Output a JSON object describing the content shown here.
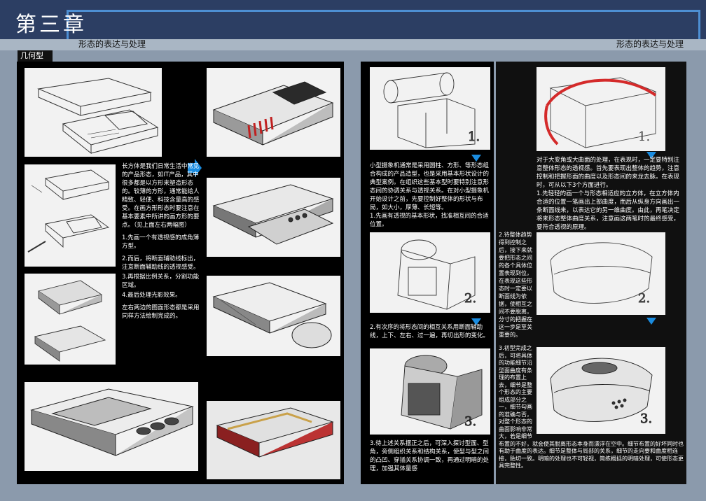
{
  "header": {
    "chapter_title": "第三章",
    "subtitle_left": "形态的表达与处理",
    "subtitle_right": "形态的表达与处理",
    "section_tag": "几何型"
  },
  "left_text": {
    "intro": "长方体是我们日常生活中常见的产品形态，如IT产品，其中很多都是以方形来塑造形态的。较薄的方形，通常能给人精致、轻便、科技含量高的感受。在画方形形态时要注意在基本要素中所讲的画方形的要点。（见上面左右两幅图）",
    "step1": "1.先画一个有透视感的成角薄方型。",
    "step2": "2.而后，将断面辅助线标出，注意断面辅助线的透视感受。",
    "step3": "3.再根据比例关系，分割功能区域。",
    "step4": "4.最后处理光影效果。",
    "outro": "左右两边的图面形态都是采用同样方法绘制完成的。"
  },
  "mid_text": {
    "intro": "小型摄象机通常是采用圆柱、方形、等形态组合构成的产品造型，也是采用基本形状设计的典型案例。在组织这些基本型时要特别注意形态间的协调关系与透视关系。在对小型摄象机开始设计之前，先要控制好整体的形状与布局，如大小，厚薄、长短等。",
    "step1": "1.先画有透视的基本形状，找准相互间的合适位置。",
    "step2": "2.有次序的将形态间的相互关系用断面辅助线，上下、左右、过一遍，再切出形的变化。",
    "step3": "3.待上述关系摆正之后，可深入探讨型面、型角，旁侧组织关系和结构关系，使型与型之间的凸凹、穿插关系协调一致，再通过明暗的处理，加强其体量感"
  },
  "right_text": {
    "intro": "对于大变角或大曲面的处理，在表现时，一定要特别注意整体形态的透视感。首先要表现出整体的趋势，注意控制和把握形面的曲度以及形态间的来龙去脉。在表现时，可从以下3个方面进行。",
    "step1": "1.先轻轻的画一个与形态相适应的立方体，在立方体内合适的位置一笔画出上部曲度，而后从纵身方向画出一条断面线来，以表达它的另一维曲度。由此，再笔决定将来形态整体曲度关系，注意画这两笔时的最终感受，要符合透视的原理。",
    "step2": "2.待整体趋势得到控制之后，接下来就要把形态之间的各个具体位置表现到位，在表现这些形态时一定要以断面线为依据，使相互之间不要脱离，分寸的把握在这一步是至关重要的。",
    "step3": "3.初型完成之后，可将具体的功能细节沿型面曲度有条理的布置上去，细节是整个形态的主要组成部分之一，细节勾画的准确与否，对整个形态的曲面影响非常大，若是细节布置的不好，就会使其脱离形态本身而漂浮在空中。细节布置的好坏同时也有助于曲度的表达。细节是整体与局部的关系，细节的走向要和曲度相连接，贴切一致。明暗的处理也不可轻视，简练概括的明暗处理，可使形态更具完整性。"
  },
  "sketch_labels": {
    "cam1": "1.",
    "cam2": "2.",
    "cam3": "3.",
    "dev1": "1.",
    "dev2": "2.",
    "dev3": "3."
  },
  "colors": {
    "header_bg": "#2c3e63",
    "frame_blue": "#4d8fd3",
    "arrow_blue": "#1a8ce0",
    "accent_red": "#d42a2a"
  }
}
